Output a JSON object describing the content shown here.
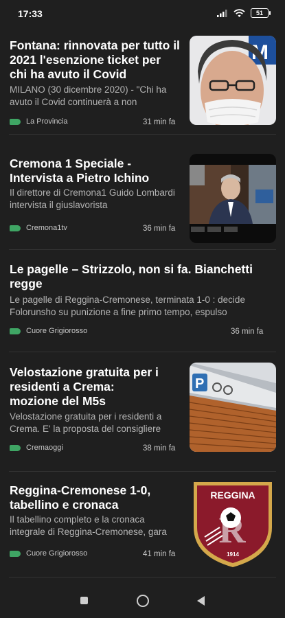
{
  "status_bar": {
    "time": "17:33",
    "battery": "51"
  },
  "articles": [
    {
      "title": "Fontana: rinnovata per tutto il 2021 l'esenzione ticket per chi ha avuto il Covid",
      "description": "MILANO (30 dicembre 2020) - \"Chi ha avuto il Covid continuerà a non",
      "source": "La Provincia",
      "time": "31 min fa",
      "thumbnail": "portrait-masked-man"
    },
    {
      "title": "Cremona 1 Speciale - Intervista a Pietro Ichino",
      "description": "Il direttore di Cremona1 Guido Lombardi intervista il giuslavorista",
      "source": "Cremona1tv",
      "time": "36 min fa",
      "thumbnail": "video-call-interview"
    },
    {
      "title": "Le pagelle – Strizzolo, non si fa. Bianchetti regge",
      "description": "Le pagelle di Reggina-Cremonese, terminata 1-0 : decide Folorunsho su punizione a fine primo tempo, espulso",
      "source": "Cuore Grigiorosso",
      "time": "36 min fa"
    },
    {
      "title": "Velostazione gratuita per i residenti a Crema: mozione del M5s",
      "description": "Velostazione gratuita per i residenti a Crema. E' la proposta del consigliere",
      "source": "Cremaoggi",
      "time": "38 min fa",
      "thumbnail": "bike-station-building"
    },
    {
      "title": "Reggina-Cremonese 1-0, tabellino e cronaca",
      "description": "Il tabellino completo e la cronaca integrale di Reggina-Cremonese, gara",
      "source": "Cuore Grigiorosso",
      "time": "41 min fa",
      "thumbnail": "reggina-logo",
      "logo_text": "REGGINA",
      "logo_year": "1914"
    }
  ],
  "colors": {
    "background": "#1f1f1f",
    "tag": "#3fa564",
    "reggina_red": "#8b1a2b",
    "reggina_gold": "#d4a84b"
  }
}
